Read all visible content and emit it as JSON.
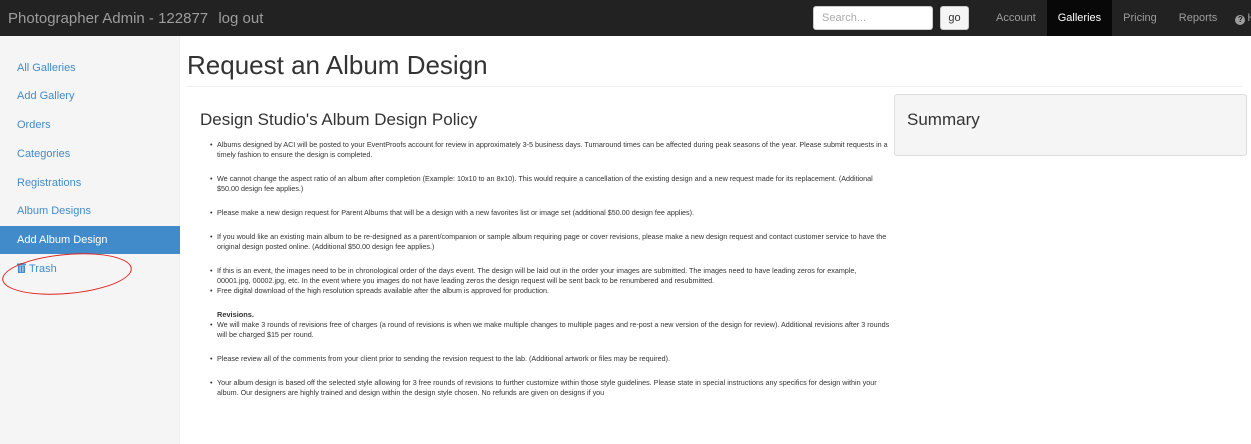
{
  "navbar": {
    "brand": "Photographer Admin - 122877",
    "logout": "log out",
    "search_placeholder": "Search...",
    "go_label": "go",
    "links": [
      {
        "label": "Account",
        "active": false
      },
      {
        "label": "Galleries",
        "active": true
      },
      {
        "label": "Pricing",
        "active": false
      },
      {
        "label": "Reports",
        "active": false
      }
    ],
    "help_label": "He"
  },
  "sidebar": {
    "items": [
      {
        "label": "All Galleries"
      },
      {
        "label": "Add Gallery"
      },
      {
        "label": "Orders"
      },
      {
        "label": "Categories"
      },
      {
        "label": "Registrations"
      },
      {
        "label": "Album Designs"
      },
      {
        "label": "Add Album Design"
      },
      {
        "label": "Trash"
      }
    ],
    "active_index": 6
  },
  "main": {
    "title": "Request an Album Design",
    "policy_heading": "Design Studio's Album Design Policy",
    "bullets": [
      "Albums designed by ACI will be posted to your EventProofs account for review in approximately 3-5 business days. Turnaround times can be affected during peak seasons of the year. Please submit requests in a timely fashion to ensure the design is completed.",
      "We cannot change the aspect ratio of an album after completion (Example: 10x10 to an 8x10). This would require a cancellation of the existing design and a new request made for its replacement. (Additional $50.00 design fee applies.)",
      "Please make a new design request for Parent Albums that will be a design with a new favorites list or image set (additional $50.00 design fee applies).",
      "If you would like an existing main album to be re-designed as a parent/companion or sample album requiring page or cover revisions, please make a new design request and contact customer service to have the original design posted online. (Additional $50.00 design fee applies.)",
      "If this is an event, the images need to be in chronological order of the days event. The design will be laid out in the order your images are submitted. The images need to have leading zeros for example, 00001.jpg, 00002.jpg, etc. In the event where you images do not have leading zeros the design request will be sent back to be renumbered and resubmitted.",
      "Free digital download of the high resolution spreads available after the album is approved for production."
    ],
    "revisions_heading": "Revisions.",
    "revision_bullets": [
      "We will make 3 rounds of revisions free of charges (a round of revisions is when we make multiple changes to multiple pages and re-post a new version of the design for review). Additional revisions after 3 rounds will be charged $15 per round.",
      "Please review all of the comments from your client prior to sending the revision request to the lab. (Additional artwork or files may be required).",
      "Your album design is based off the selected style allowing for 3 free rounds of revisions to further customize within those style guidelines. Please state in special instructions any specifics for design within your album. Our designers are highly trained and design within the design style chosen. No refunds are given on designs if you"
    ]
  },
  "summary": {
    "title": "Summary"
  },
  "colors": {
    "navbar_bg": "#222222",
    "link": "#428bca",
    "active_bg": "#428bca",
    "annotation": "#e02020"
  }
}
